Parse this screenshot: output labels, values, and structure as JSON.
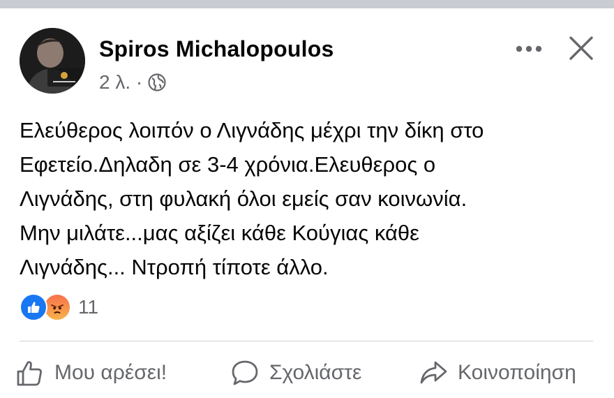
{
  "post": {
    "author": "Spiros Michalopoulos",
    "time": "2 λ. ·",
    "privacy_icon": "globe-icon",
    "text_lines": [
      "Ελεύθερος λοιπόν ο Λιγνάδης μέχρι την δίκη στο",
      "Εφετείο.Δηλαδη σε 3-4 χρόνια.Ελευθερος ο",
      "Λιγνάδης, στη φυλακή όλοι εμείς σαν κοινωνία.",
      "Μην μιλάτε...μας αξίζει κάθε Κούγιας κάθε",
      "Λιγνάδης... Ντροπή τίποτε άλλο."
    ],
    "reactions": {
      "icons": [
        "like-icon",
        "angry-icon"
      ],
      "count": "11"
    }
  },
  "actions": {
    "like": "Μου αρέσει!",
    "comment": "Σχολιάστε",
    "share": "Κοινοποίηση"
  },
  "colors": {
    "background": "#ffffff",
    "text": "#050505",
    "secondary_text": "#65676b",
    "like_blue": "#1877f2",
    "angry_orange": "#f7714c",
    "divider": "#ced0d4"
  }
}
